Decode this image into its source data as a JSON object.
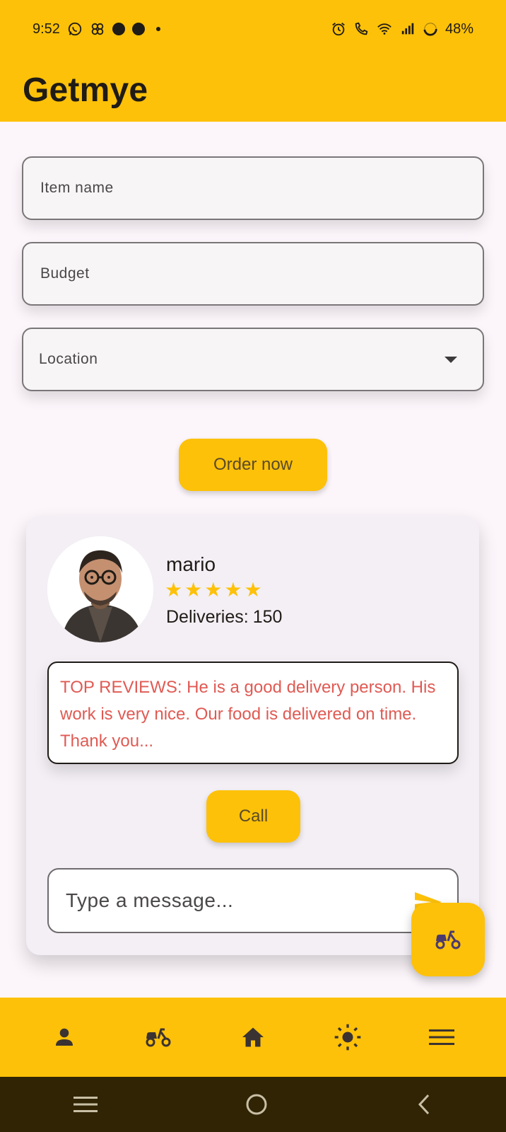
{
  "status_bar": {
    "time": "9:52",
    "battery": "48%",
    "icons_left": [
      "whatsapp-icon",
      "pinwheel-icon",
      "notification-dot-icon",
      "notification-dot-icon",
      "more-dot-icon"
    ],
    "icons_right": [
      "alarm-icon",
      "wifi-calling-icon",
      "wifi-icon",
      "signal-icon",
      "battery-icon"
    ]
  },
  "app": {
    "title": "Getmye",
    "accent_color": "#fdc109"
  },
  "form": {
    "item_name_placeholder": "Item name",
    "budget_placeholder": "Budget",
    "location_label": "Location",
    "order_button": "Order now"
  },
  "courier": {
    "name": "mario",
    "rating": 5,
    "rating_max": 5,
    "deliveries_label": "Deliveries:",
    "deliveries_count": "150",
    "review": "TOP REVIEWS: He is a good delivery person. His work is very nice. Our food is delivered on time. Thank you...",
    "call_button": "Call",
    "message_placeholder": "Type a message..."
  },
  "fab": {
    "icon": "scooter-icon"
  },
  "bottom_nav": {
    "items": [
      {
        "icon": "person-icon"
      },
      {
        "icon": "scooter-icon"
      },
      {
        "icon": "home-icon"
      },
      {
        "icon": "sun-icon"
      },
      {
        "icon": "menu-icon"
      }
    ]
  },
  "system_nav": {
    "items": [
      {
        "icon": "recents-icon"
      },
      {
        "icon": "home-circle-icon"
      },
      {
        "icon": "back-icon"
      }
    ]
  }
}
